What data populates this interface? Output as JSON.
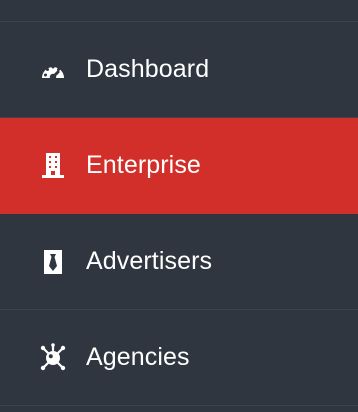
{
  "sidebar": {
    "items": [
      {
        "label": "Dashboard",
        "icon": "dashboard-gauge-icon",
        "active": false
      },
      {
        "label": "Enterprise",
        "icon": "building-icon",
        "active": true
      },
      {
        "label": "Advertisers",
        "icon": "tie-icon",
        "active": false
      },
      {
        "label": "Agencies",
        "icon": "network-hub-icon",
        "active": false
      }
    ]
  },
  "colors": {
    "sidebar_background": "#2f3640",
    "active_background": "#d32f2a",
    "text": "#ffffff",
    "divider": "#3b434d"
  }
}
